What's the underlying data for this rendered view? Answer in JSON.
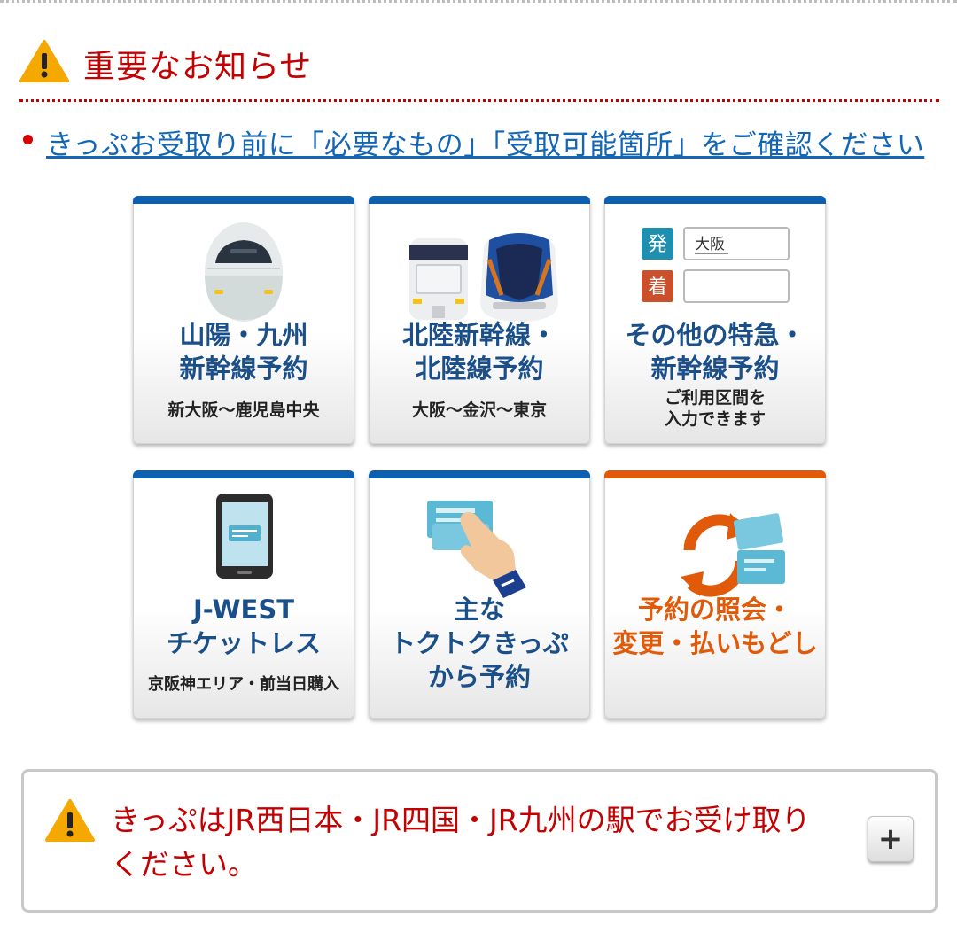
{
  "notice": {
    "title": "重要なお知らせ",
    "link": "きっぷお受取り前に「必要なもの」「受取可能箇所」をご確認ください"
  },
  "tiles": [
    {
      "title": [
        "山陽・九州",
        "新幹線予約"
      ],
      "sub": [
        "新大阪～鹿児島中央"
      ],
      "icon": "shinkansen-n700-icon"
    },
    {
      "title": [
        "北陸新幹線・",
        "北陸線予約"
      ],
      "sub": [
        "大阪～金沢～東京"
      ],
      "icon": "hokuriku-trains-icon"
    },
    {
      "title": [
        "その他の特急・",
        "新幹線予約"
      ],
      "sub": [
        "ご利用区間を",
        "入力できます"
      ],
      "icon": "route-input-icon",
      "route": {
        "from_label": "発",
        "from_value": "大阪",
        "to_label": "着",
        "to_value": ""
      }
    },
    {
      "title": [
        "J-WEST",
        "チケットレス"
      ],
      "sub": [
        "京阪神エリア・前当日購入"
      ],
      "icon": "smartphone-ticket-icon"
    },
    {
      "title": [
        "主な",
        "トクトクきっぷ",
        "から予約"
      ],
      "sub": [],
      "icon": "hand-card-icon"
    },
    {
      "title": [
        "予約の照会・",
        "変更・払いもどし"
      ],
      "sub": [],
      "icon": "refresh-tickets-icon"
    }
  ],
  "footer": {
    "text": "きっぷはJR西日本・JR四国・JR九州の駅でお受け取りください。",
    "expand_label": "+"
  },
  "colors": {
    "accent_blue": "#0d5fb0",
    "accent_orange": "#e05a0a",
    "notice_red": "#c40000",
    "link_blue": "#1366b6"
  }
}
